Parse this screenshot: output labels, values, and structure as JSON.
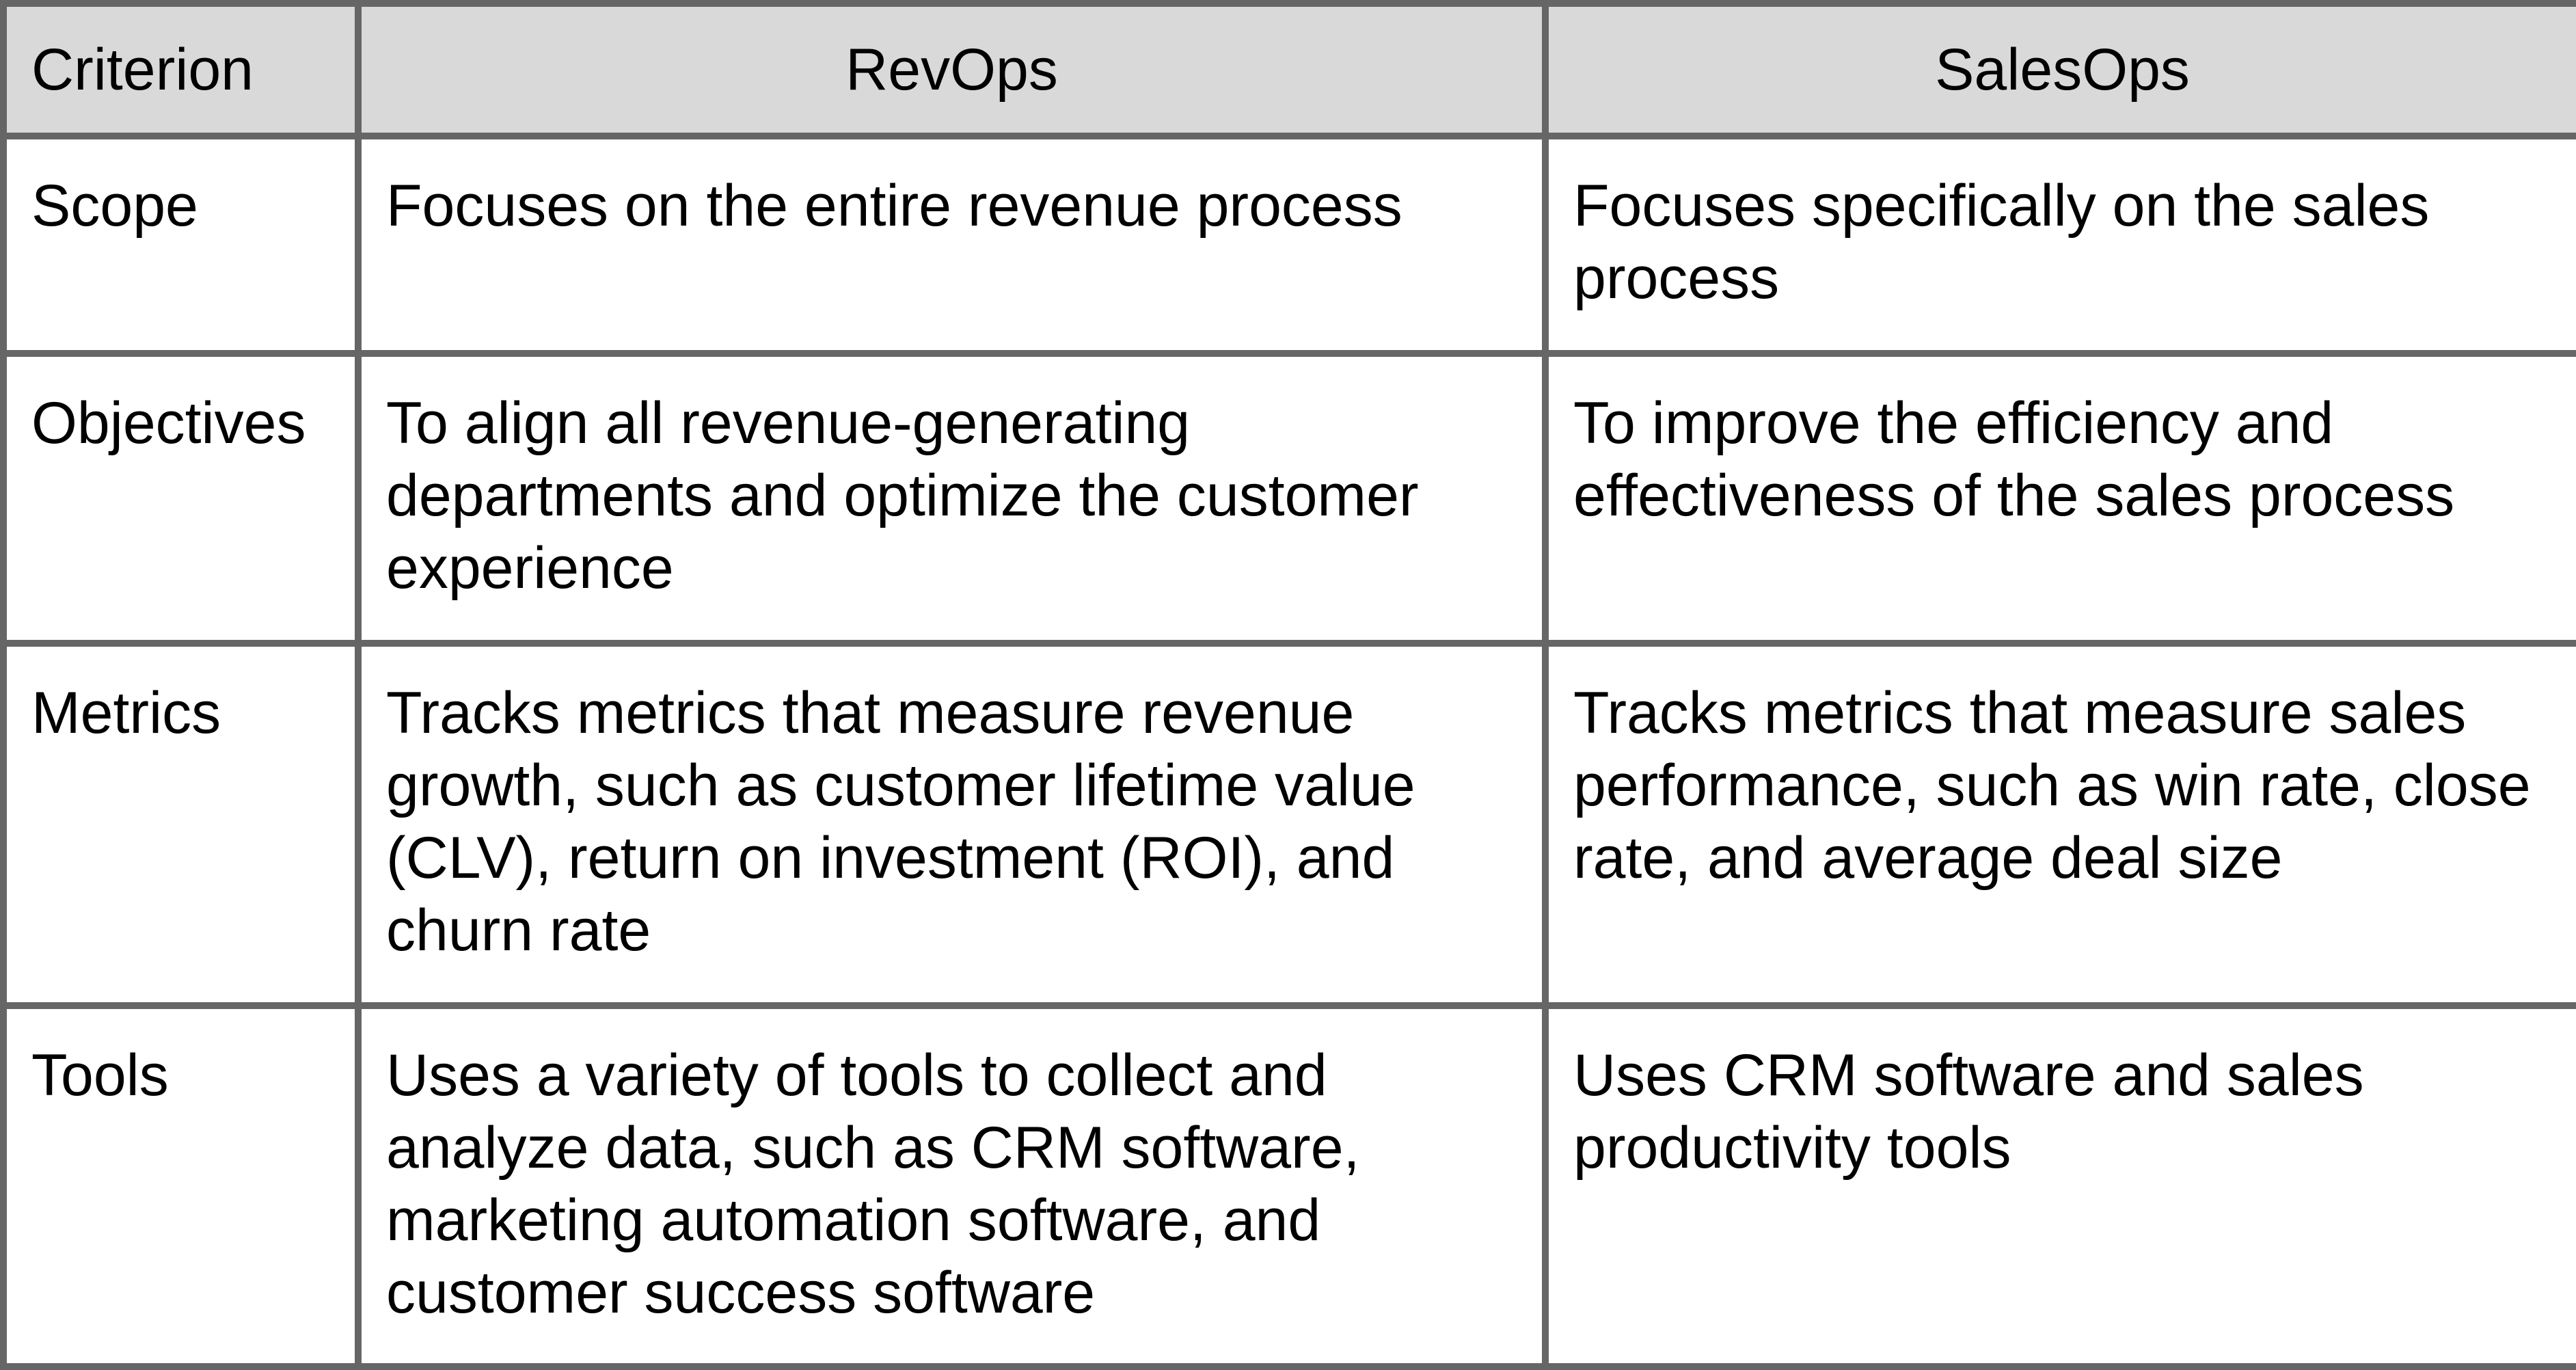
{
  "table": {
    "headers": [
      "Criterion",
      "RevOps",
      "SalesOps"
    ],
    "rows": [
      {
        "criterion": "Scope",
        "revops": "Focuses on the entire revenue process",
        "salesops": "Focuses specifically on the sales process"
      },
      {
        "criterion": "Objectives",
        "revops": "To align all revenue-generating departments and optimize the customer experience",
        "salesops": "To improve the efficiency and effectiveness of the sales process"
      },
      {
        "criterion": "Metrics",
        "revops": "Tracks metrics that measure revenue growth, such as customer lifetime value (CLV), return on investment (ROI), and churn rate",
        "salesops": "Tracks metrics that measure sales performance, such as win rate, close rate, and average deal size"
      },
      {
        "criterion": "Tools",
        "revops": "Uses a variety of tools to collect and analyze data, such as CRM software, marketing automation software, and customer success software",
        "salesops": "Uses CRM software and sales productivity tools"
      }
    ]
  },
  "colors": {
    "border": "#666666",
    "header_background": "#d9d9d9",
    "cell_background": "#ffffff",
    "text": "#000000"
  }
}
